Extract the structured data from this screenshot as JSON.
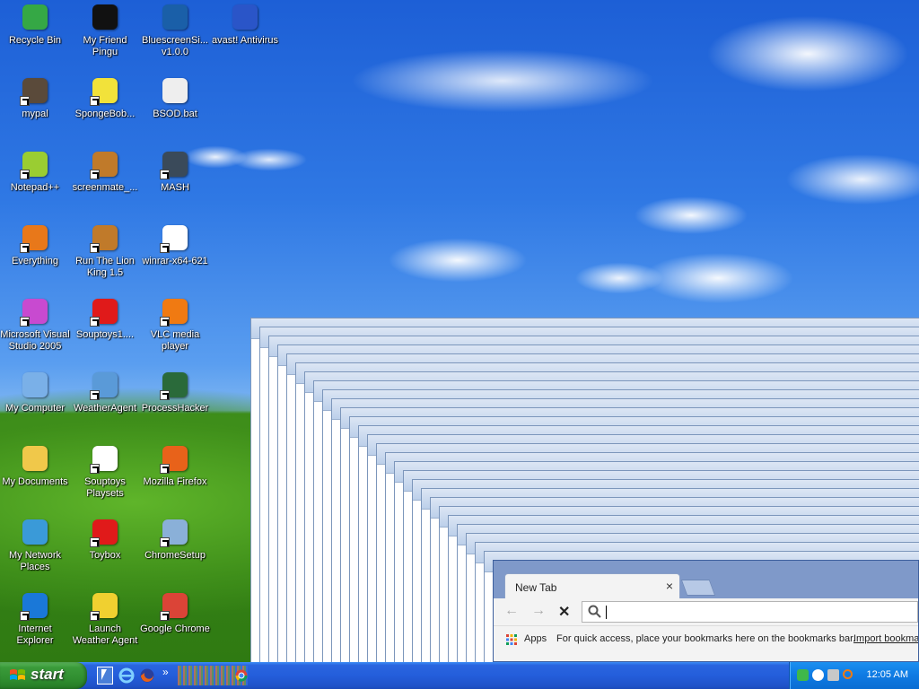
{
  "desktop_icons": [
    {
      "label": "Recycle Bin",
      "icon": "recycle-bin-icon",
      "color": "#35a845"
    },
    {
      "label": "My Friend Pingu",
      "icon": "penguin-icon",
      "color": "#111111"
    },
    {
      "label": "BluescreenSi... v1.0.0",
      "icon": "sad-face-icon",
      "color": "#1a5fa8"
    },
    {
      "label": "avast! Antivirus",
      "icon": "avast-icon",
      "color": "#2a55c8"
    },
    {
      "label": "mypal",
      "icon": "raccoon-icon",
      "color": "#5a4a3a"
    },
    {
      "label": "SpongeBob...",
      "icon": "spongebob-icon",
      "color": "#f2e23a"
    },
    {
      "label": "BSOD.bat",
      "icon": "batch-file-icon",
      "color": "#eeeeee"
    },
    {
      "label": "Notepad++",
      "icon": "notepad-icon",
      "color": "#9acd32"
    },
    {
      "label": "screenmate_...",
      "icon": "screenmate-icon",
      "color": "#c07a2a"
    },
    {
      "label": "MASH",
      "icon": "helicopter-icon",
      "color": "#3a4a5a"
    },
    {
      "label": "Everything",
      "icon": "search-ring-icon",
      "color": "#e8781a"
    },
    {
      "label": "Run The Lion King 1.5",
      "icon": "lion-king-icon",
      "color": "#c07a2a"
    },
    {
      "label": "winrar-x64-621",
      "icon": "window-icon",
      "color": "#ffffff"
    },
    {
      "label": "Microsoft Visual Studio 2005",
      "icon": "visual-studio-icon",
      "color": "#c84ad0"
    },
    {
      "label": "Souptoys1....",
      "icon": "souptoys-icon",
      "color": "#e01a1a"
    },
    {
      "label": "VLC media player",
      "icon": "vlc-cone-icon",
      "color": "#f07a12"
    },
    {
      "label": "My Computer",
      "icon": "computer-icon",
      "color": "#7ab0e8"
    },
    {
      "label": "WeatherAgent",
      "icon": "weather-icon",
      "color": "#5a9ad8"
    },
    {
      "label": "ProcessHacker",
      "icon": "process-hacker-icon",
      "color": "#2a6a3a"
    },
    {
      "label": "My Documents",
      "icon": "folder-icon",
      "color": "#f0c84a"
    },
    {
      "label": "Souptoys Playsets",
      "icon": "window-icon",
      "color": "#ffffff"
    },
    {
      "label": "Mozilla Firefox",
      "icon": "firefox-icon",
      "color": "#e8621a"
    },
    {
      "label": "My Network Places",
      "icon": "network-icon",
      "color": "#3a9ad8"
    },
    {
      "label": "Toybox",
      "icon": "souptoys-icon",
      "color": "#e01a1a"
    },
    {
      "label": "ChromeSetup",
      "icon": "installer-icon",
      "color": "#8ab0d8"
    },
    {
      "label": "Internet Explorer",
      "icon": "internet-explorer-icon",
      "color": "#1a78d8"
    },
    {
      "label": "Launch Weather Agent",
      "icon": "weather-agent-icon",
      "color": "#f0d030"
    },
    {
      "label": "Google Chrome",
      "icon": "chrome-icon",
      "color": "#db4437"
    }
  ],
  "chrome": {
    "tab_title": "New Tab",
    "tab_close": "×",
    "back": "←",
    "forward": "→",
    "stop": "✕",
    "bookmarks_apps": "Apps",
    "bookmarks_hint": "For quick access, place your bookmarks here on the bookmarks bar.",
    "bookmarks_import": "Import bookmarks..."
  },
  "taskbar": {
    "start_label": "start",
    "overflow": "»",
    "clock": "12:05 AM"
  },
  "colors": {
    "taskbar": "#245edb",
    "start": "#3a9b3a",
    "tray": "#0f7ae3"
  }
}
